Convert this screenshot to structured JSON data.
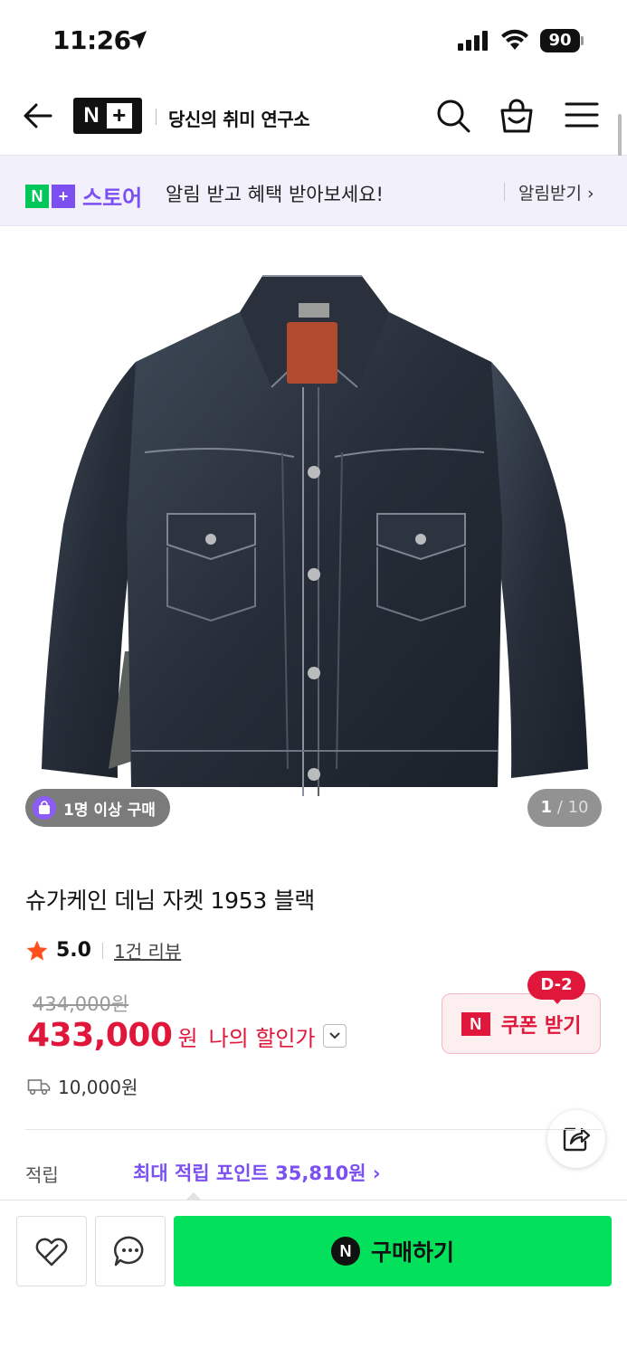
{
  "status_bar": {
    "time": "11:26",
    "battery": "90"
  },
  "header": {
    "logo_n": "N",
    "logo_plus": "+",
    "tagline": "당신의 취미 연구소"
  },
  "notice": {
    "store_n": "N",
    "store_plus": "+",
    "store_name": "스토어",
    "text": "알림 받고 혜택 받아보세요!",
    "link": "알림받기 ›"
  },
  "gallery": {
    "badge": "1명 이상 구매",
    "current": "1",
    "separator": "/",
    "total": "10"
  },
  "product": {
    "title": "슈가케인 데님 자켓 1953 블랙",
    "rating": "5.0",
    "reviews": "1건 리뷰",
    "original_price": "434,000원",
    "price": "433,000",
    "price_unit": "원",
    "price_label": "나의 할인가",
    "shipping": "10,000원"
  },
  "coupon": {
    "tag": "D-2",
    "mark": "N",
    "label": "쿠폰 받기"
  },
  "points": {
    "label": "적립",
    "link": "최대 적립 포인트 35,810원 ›"
  },
  "bottom_bar": {
    "buy_mark": "N",
    "buy_label": "구매하기"
  },
  "colors": {
    "accent_purple": "#7b4ff0",
    "price_red": "#e0163b",
    "naver_green": "#03e05b"
  }
}
